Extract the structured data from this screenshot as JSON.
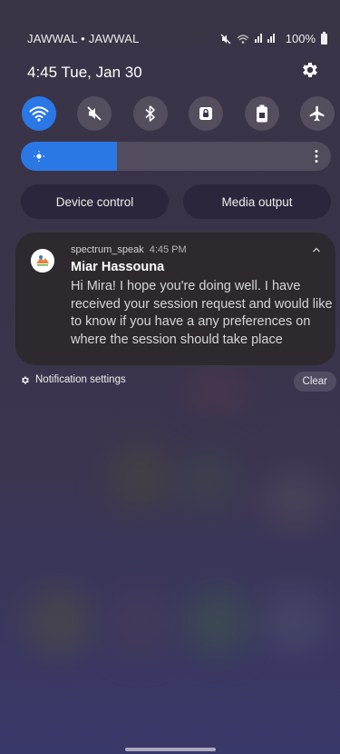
{
  "status": {
    "carrier": "JAWWAL • JAWWAL",
    "battery": "100%"
  },
  "header": {
    "datetime": "4:45  Tue, Jan 30"
  },
  "quick_settings": [
    {
      "name": "wifi-icon",
      "active": true
    },
    {
      "name": "sound-mute-icon",
      "active": false
    },
    {
      "name": "bluetooth-icon",
      "active": false
    },
    {
      "name": "rotation-lock-icon",
      "active": false
    },
    {
      "name": "power-saving-icon",
      "active": false
    },
    {
      "name": "airplane-icon",
      "active": false
    }
  ],
  "brightness": {
    "level": 0.31
  },
  "pills": {
    "device_control": "Device control",
    "media_output": "Media output"
  },
  "notification": {
    "app_name": "spectrum_speak",
    "time": "4:45 PM",
    "title": "Miar Hassouna",
    "body": "Hi Mira! I hope you're doing well. I have received your session request and would like to know if you have a any preferences on where the session should take place"
  },
  "footer": {
    "settings_label": "Notification settings",
    "clear_label": "Clear"
  },
  "colors": {
    "accent": "#2a78e6"
  }
}
